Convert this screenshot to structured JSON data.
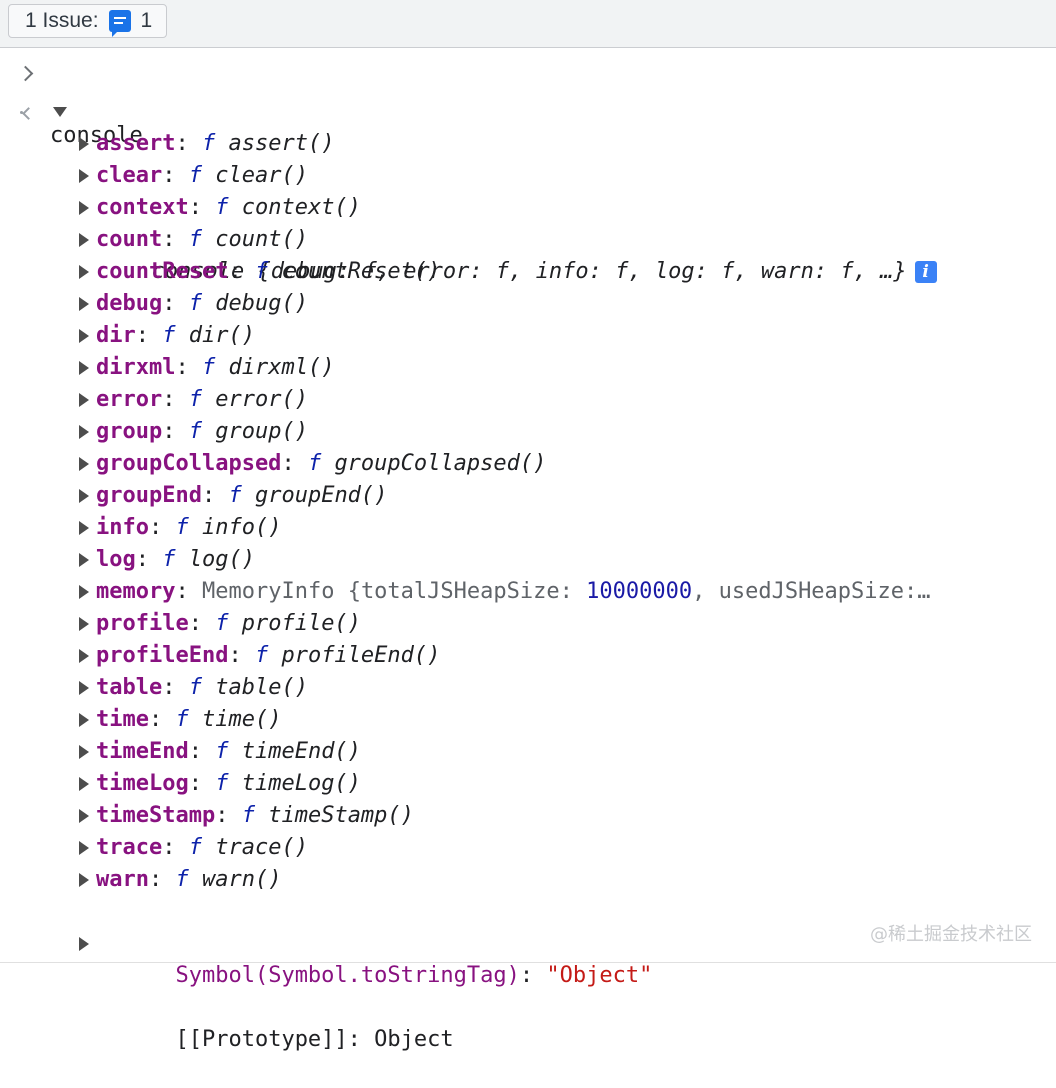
{
  "toolbar": {
    "issue_count_label": "1 Issue:",
    "issue_badge_count": "1"
  },
  "input": {
    "command": "console"
  },
  "result": {
    "name": "console",
    "preview_open": "{",
    "preview_pairs": [
      {
        "k": "debug",
        "v": "f"
      },
      {
        "k": "error",
        "v": "f"
      },
      {
        "k": "info",
        "v": "f"
      },
      {
        "k": "log",
        "v": "f"
      },
      {
        "k": "warn",
        "v": "f"
      }
    ],
    "preview_more": "…}",
    "info_badge": "i"
  },
  "properties": [
    {
      "name": "assert",
      "type": "f",
      "value": "assert()"
    },
    {
      "name": "clear",
      "type": "f",
      "value": "clear()"
    },
    {
      "name": "context",
      "type": "f",
      "value": "context()"
    },
    {
      "name": "count",
      "type": "f",
      "value": "count()"
    },
    {
      "name": "countReset",
      "type": "f",
      "value": "countReset()"
    },
    {
      "name": "debug",
      "type": "f",
      "value": "debug()"
    },
    {
      "name": "dir",
      "type": "f",
      "value": "dir()"
    },
    {
      "name": "dirxml",
      "type": "f",
      "value": "dirxml()"
    },
    {
      "name": "error",
      "type": "f",
      "value": "error()"
    },
    {
      "name": "group",
      "type": "f",
      "value": "group()"
    },
    {
      "name": "groupCollapsed",
      "type": "f",
      "value": "groupCollapsed()"
    },
    {
      "name": "groupEnd",
      "type": "f",
      "value": "groupEnd()"
    },
    {
      "name": "info",
      "type": "f",
      "value": "info()"
    },
    {
      "name": "log",
      "type": "f",
      "value": "log()"
    },
    {
      "name": "memory",
      "type": "object"
    },
    {
      "name": "profile",
      "type": "f",
      "value": "profile()"
    },
    {
      "name": "profileEnd",
      "type": "f",
      "value": "profileEnd()"
    },
    {
      "name": "table",
      "type": "f",
      "value": "table()"
    },
    {
      "name": "time",
      "type": "f",
      "value": "time()"
    },
    {
      "name": "timeEnd",
      "type": "f",
      "value": "timeEnd()"
    },
    {
      "name": "timeLog",
      "type": "f",
      "value": "timeLog()"
    },
    {
      "name": "timeStamp",
      "type": "f",
      "value": "timeStamp()"
    },
    {
      "name": "trace",
      "type": "f",
      "value": "trace()"
    },
    {
      "name": "warn",
      "type": "f",
      "value": "warn()"
    }
  ],
  "memory": {
    "class": "MemoryInfo",
    "open": "{",
    "k1": "totalJSHeapSize",
    "v1": "10000000",
    "k2": "usedJSHeapSize",
    "tail": ":…"
  },
  "symbol": {
    "key": "Symbol(Symbol.toStringTag)",
    "value": "\"Object\""
  },
  "prototype": {
    "key": "[[Prototype]]",
    "value": "Object"
  },
  "watermark": "@稀土掘金技术社区",
  "colors": {
    "key_purple": "#881280",
    "function_f_blue": "#0d22aa",
    "number_blue": "#1a1aa6",
    "string_red": "#c41a16",
    "issue_blue": "#1a73e8",
    "info_badge_blue": "#3b82f6"
  }
}
